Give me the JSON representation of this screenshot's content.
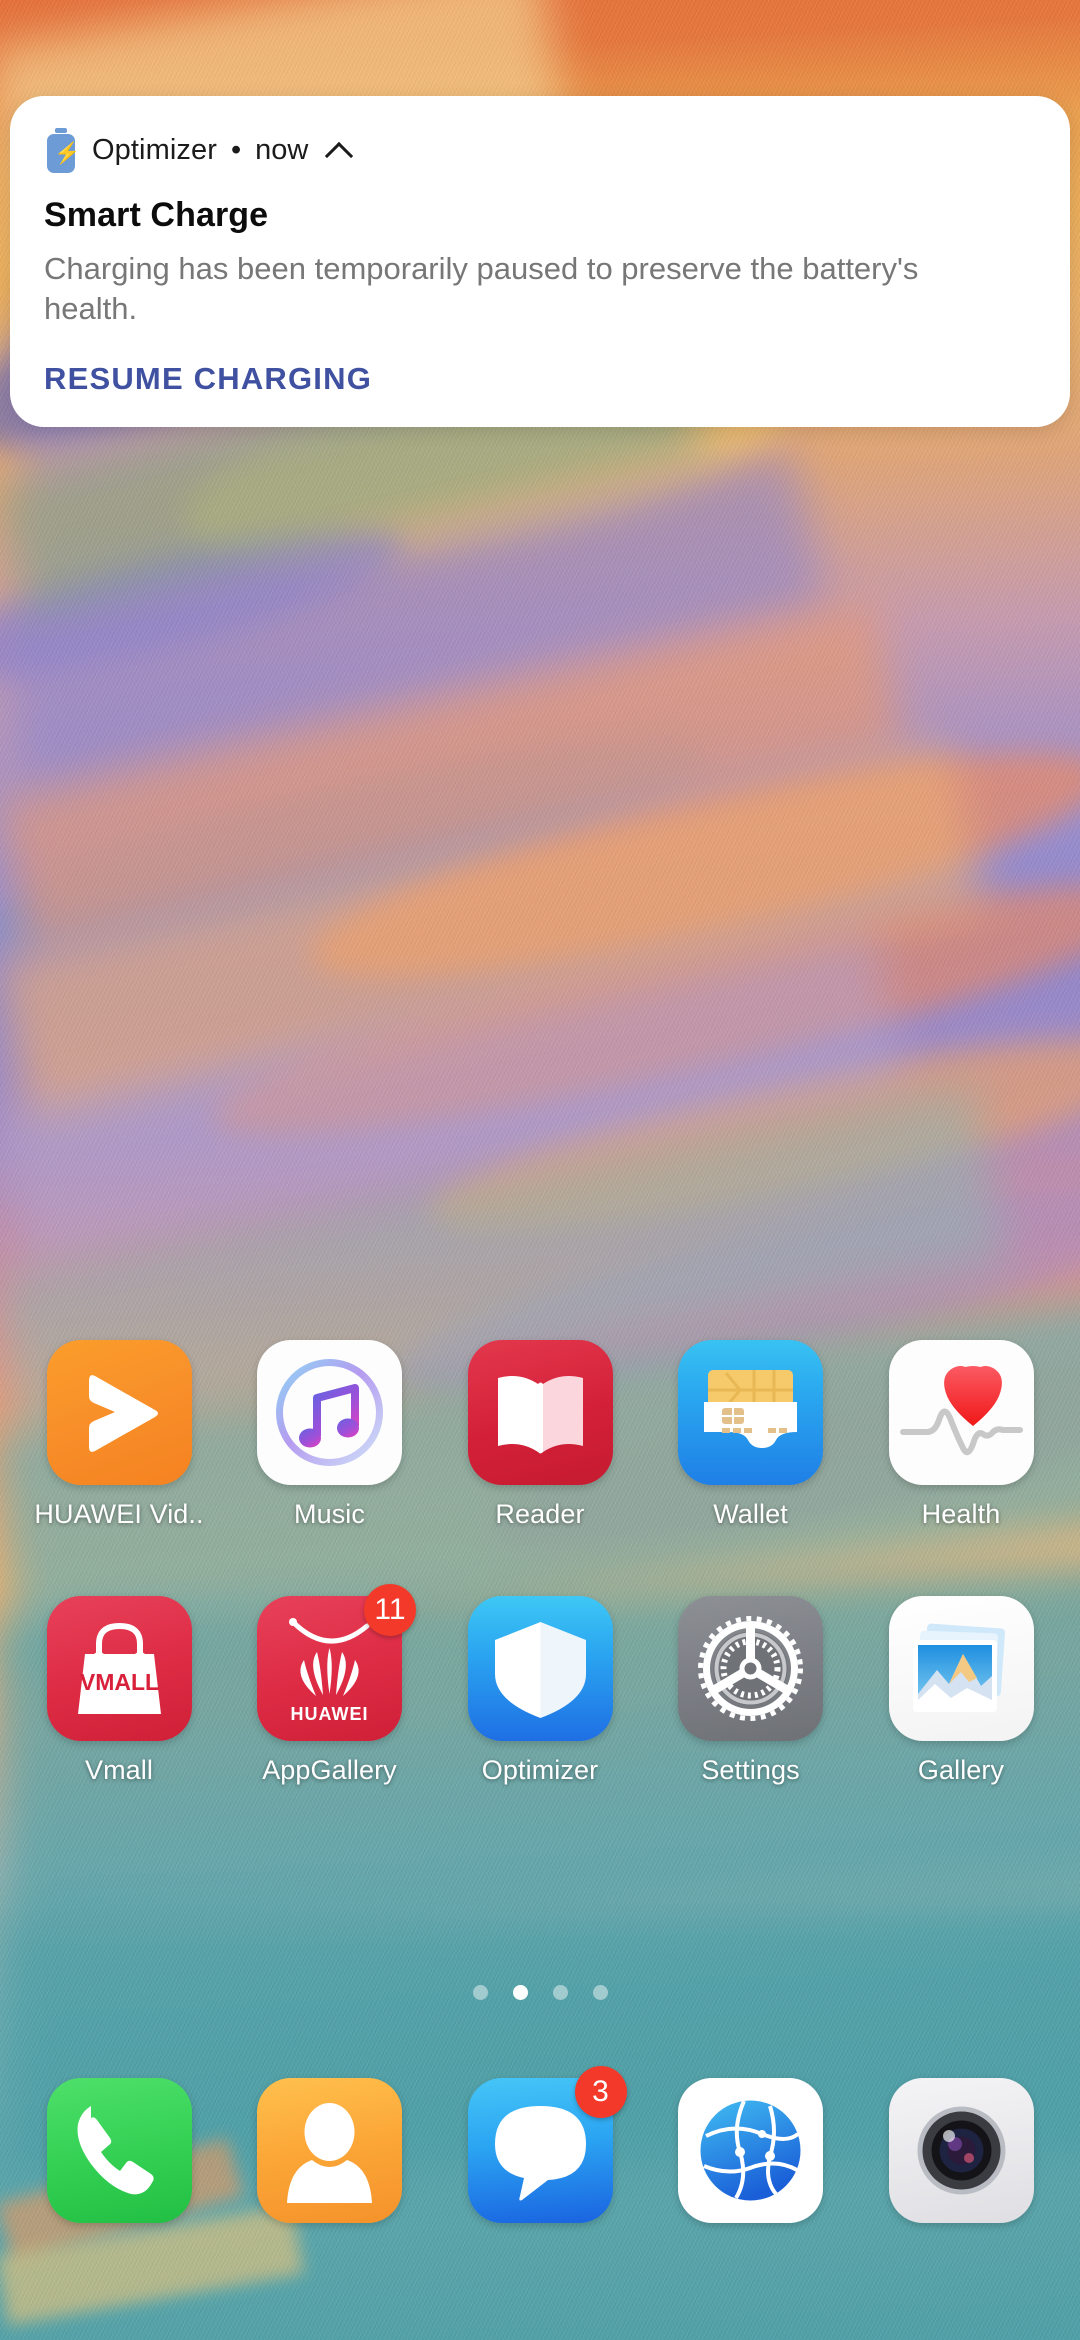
{
  "notification": {
    "icon": "battery-charging-icon",
    "app_name": "Optimizer",
    "separator": "•",
    "time": "now",
    "expand_icon": "chevron-up-icon",
    "title": "Smart Charge",
    "body": "Charging has been temporarily paused to preserve the battery's health.",
    "action_label": "RESUME CHARGING",
    "action_color": "#3f51a0"
  },
  "home": {
    "rows": [
      [
        {
          "label": "HUAWEI Vid..",
          "icon": "huawei-video-icon",
          "badge": null
        },
        {
          "label": "Music",
          "icon": "music-icon",
          "badge": null
        },
        {
          "label": "Reader",
          "icon": "reader-icon",
          "badge": null
        },
        {
          "label": "Wallet",
          "icon": "wallet-icon",
          "badge": null
        },
        {
          "label": "Health",
          "icon": "health-icon",
          "badge": null
        }
      ],
      [
        {
          "label": "Vmall",
          "icon": "vmall-icon",
          "badge": null
        },
        {
          "label": "AppGallery",
          "icon": "appgallery-icon",
          "badge": "11"
        },
        {
          "label": "Optimizer",
          "icon": "optimizer-icon",
          "badge": null
        },
        {
          "label": "Settings",
          "icon": "settings-icon",
          "badge": null
        },
        {
          "label": "Gallery",
          "icon": "gallery-icon",
          "badge": null
        }
      ]
    ],
    "page_dots": {
      "count": 4,
      "active_index": 1
    },
    "dock": [
      {
        "label": "",
        "icon": "phone-icon",
        "badge": null
      },
      {
        "label": "",
        "icon": "contacts-icon",
        "badge": null
      },
      {
        "label": "",
        "icon": "messages-icon",
        "badge": "3"
      },
      {
        "label": "",
        "icon": "browser-icon",
        "badge": null
      },
      {
        "label": "",
        "icon": "camera-icon",
        "badge": null
      }
    ]
  },
  "colors": {
    "badge_red": "#f33a2a",
    "notif_bg": "#ffffff",
    "label_white": "#ffffff"
  },
  "text": {
    "vmall_wordmark": "VMALL",
    "huawei_wordmark": "HUAWEI"
  }
}
